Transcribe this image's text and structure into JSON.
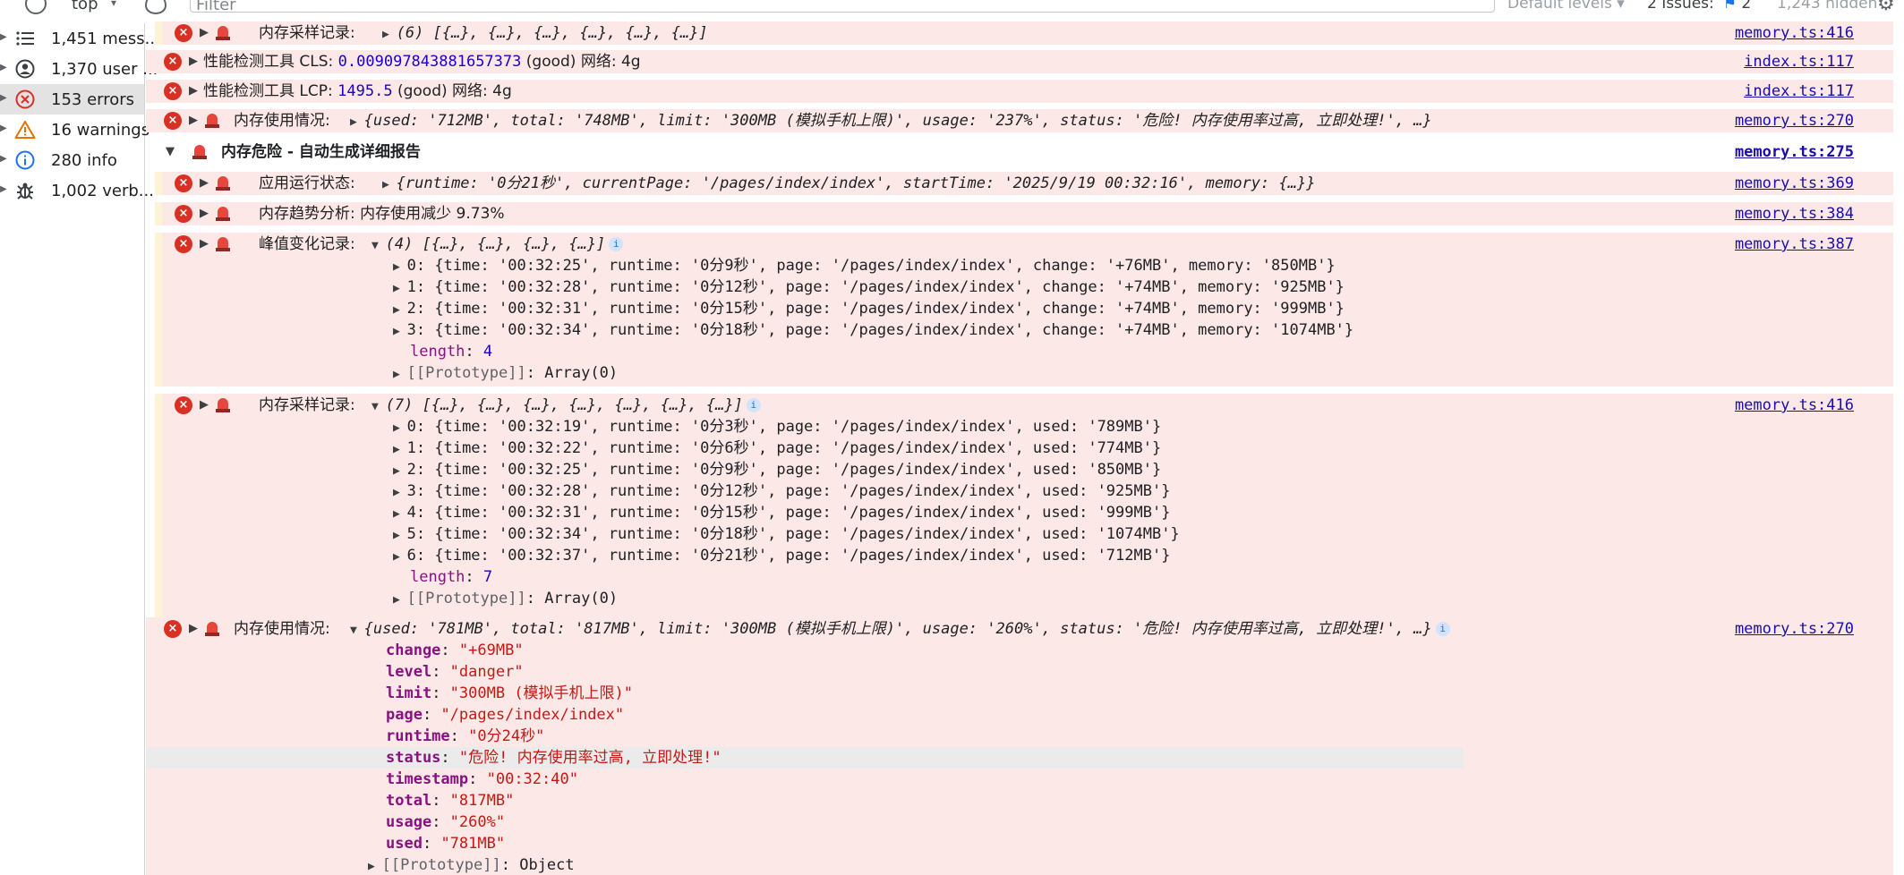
{
  "toolbar": {
    "context": "top",
    "filter_placeholder": "Filter",
    "levels": "Default levels ▾",
    "issues": "2 Issues:",
    "issues_count": "2",
    "hidden": "1,243 hidden"
  },
  "sidebar": {
    "items": [
      {
        "label": "1,451 mess...",
        "icon": "list-icon"
      },
      {
        "label": "1,370 user ...",
        "icon": "user-icon"
      },
      {
        "label": "153 errors",
        "icon": "error-icon"
      },
      {
        "label": "16 warnings",
        "icon": "warning-icon"
      },
      {
        "label": "280 info",
        "icon": "info-icon"
      },
      {
        "label": "1,002 verb...",
        "icon": "bug-icon"
      }
    ]
  },
  "console": {
    "r1": {
      "label": "内存采样记录:",
      "preview": "(6) [{…}, {…}, {…}, {…}, {…}, {…}]",
      "source": "memory.ts:416"
    },
    "r2": {
      "label": "性能检测工具 CLS:",
      "value": "0.009097843881657373",
      "rest": "(good) 网络: 4g",
      "source": "index.ts:117"
    },
    "r3": {
      "label": "性能检测工具 LCP:",
      "value": "1495.5",
      "rest": "(good) 网络: 4g",
      "source": "index.ts:117"
    },
    "r4": {
      "label": "内存使用情况:",
      "source": "memory.ts:270",
      "preview": "{used: '712MB', total: '748MB', limit: '300MB (模拟手机上限)', usage: '237%', status: '危险! 内存使用率过高, 立即处理!', …}"
    },
    "group": {
      "title": "内存危险 - 自动生成详细报告",
      "source": "memory.ts:275"
    },
    "r5": {
      "label": "应用运行状态:",
      "source": "memory.ts:369",
      "preview": "{runtime: '0分21秒', currentPage: '/pages/index/index', startTime: '2025/9/19 00:32:16', memory: {…}}"
    },
    "r6": {
      "label": "内存趋势分析: 内存使用减少 9.73%",
      "source": "memory.ts:384"
    },
    "r7": {
      "label": "峰值变化记录:",
      "preview": "(4) [{…}, {…}, {…}, {…}]",
      "source": "memory.ts:387",
      "items": [
        "0: {time: '00:32:25', runtime: '0分9秒', page: '/pages/index/index', change: '+76MB', memory: '850MB'}",
        "1: {time: '00:32:28', runtime: '0分12秒', page: '/pages/index/index', change: '+74MB', memory: '925MB'}",
        "2: {time: '00:32:31', runtime: '0分15秒', page: '/pages/index/index', change: '+74MB', memory: '999MB'}",
        "3: {time: '00:32:34', runtime: '0分18秒', page: '/pages/index/index', change: '+74MB', memory: '1074MB'}"
      ],
      "length": "4",
      "proto": "Array(0)"
    },
    "r8": {
      "label": "内存采样记录:",
      "preview": "(7) [{…}, {…}, {…}, {…}, {…}, {…}, {…}]",
      "source": "memory.ts:416",
      "items": [
        "0: {time: '00:32:19', runtime: '0分3秒', page: '/pages/index/index', used: '789MB'}",
        "1: {time: '00:32:22', runtime: '0分6秒', page: '/pages/index/index', used: '774MB'}",
        "2: {time: '00:32:25', runtime: '0分9秒', page: '/pages/index/index', used: '850MB'}",
        "3: {time: '00:32:28', runtime: '0分12秒', page: '/pages/index/index', used: '925MB'}",
        "4: {time: '00:32:31', runtime: '0分15秒', page: '/pages/index/index', used: '999MB'}",
        "5: {time: '00:32:34', runtime: '0分18秒', page: '/pages/index/index', used: '1074MB'}",
        "6: {time: '00:32:37', runtime: '0分21秒', page: '/pages/index/index', used: '712MB'}"
      ],
      "length": "7",
      "proto": "Array(0)"
    },
    "r9": {
      "label": "内存使用情况:",
      "source": "memory.ts:270",
      "preview": "{used: '781MB', total: '817MB', limit: '300MB (模拟手机上限)', usage: '260%', status: '危险! 内存使用率过高, 立即处理!', …}",
      "props": [
        {
          "key": "change",
          "value": "\"+69MB\""
        },
        {
          "key": "level",
          "value": "\"danger\""
        },
        {
          "key": "limit",
          "value": "\"300MB (模拟手机上限)\""
        },
        {
          "key": "page",
          "value": "\"/pages/index/index\""
        },
        {
          "key": "runtime",
          "value": "\"0分24秒\""
        },
        {
          "key": "status",
          "value": "\"危险! 内存使用率过高, 立即处理!\""
        },
        {
          "key": "timestamp",
          "value": "\"00:32:40\""
        },
        {
          "key": "total",
          "value": "\"817MB\""
        },
        {
          "key": "usage",
          "value": "\"260%\""
        },
        {
          "key": "used",
          "value": "\"781MB\""
        }
      ],
      "proto": "Object"
    }
  },
  "colors": {
    "error_bg": "#fce8e6",
    "error_icon": "#d93025",
    "key": "#881280",
    "string": "#c41a16",
    "number": "#1c00cf",
    "link": "#1a0dab"
  }
}
